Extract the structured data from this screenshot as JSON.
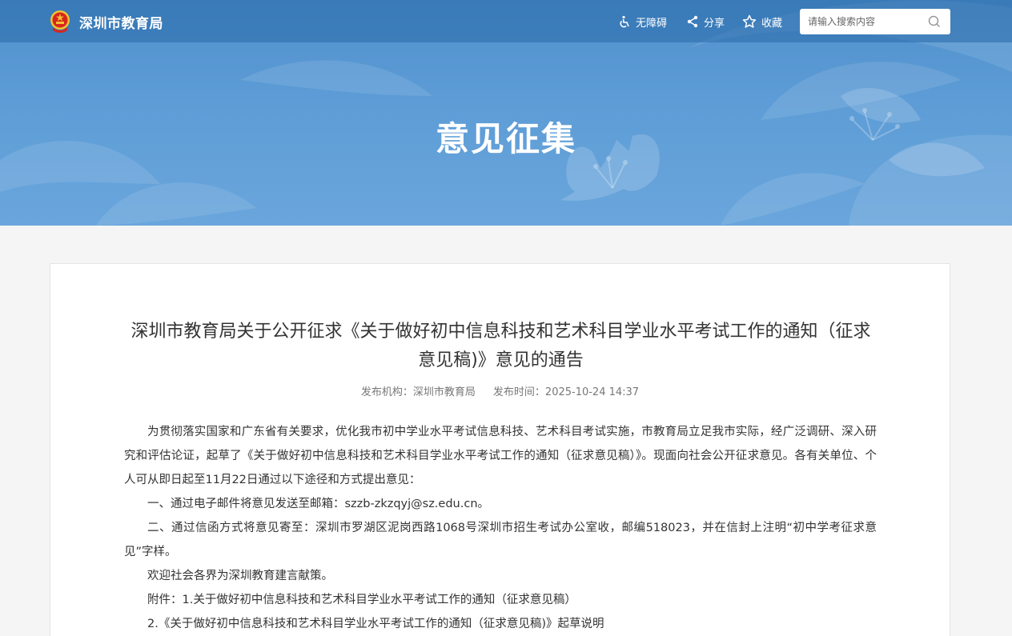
{
  "header": {
    "site_name": "深圳市教育局",
    "tools": {
      "accessibility": "无障碍",
      "share": "分享",
      "favorite": "收藏"
    },
    "search": {
      "placeholder": "请输入搜索内容",
      "value": ""
    }
  },
  "banner": {
    "title": "意见征集"
  },
  "article": {
    "title": "深圳市教育局关于公开征求《关于做好初中信息科技和艺术科目学业水平考试工作的通知（征求意见稿)》意见的通告",
    "publisher": "发布机构：深圳市教育局",
    "publish_time": "发布时间：2025-10-24 14:37",
    "paragraphs": [
      "为贯彻落实国家和广东省有关要求，优化我市初中学业水平考试信息科技、艺术科目考试实施，市教育局立足我市实际，经广泛调研、深入研究和评估论证，起草了《关于做好初中信息科技和艺术科目学业水平考试工作的通知（征求意见稿）》。现面向社会公开征求意见。各有关单位、个人可从即日起至11月22日通过以下途径和方式提出意见：",
      "一、通过电子邮件将意见发送至邮箱：szzb-zkzqyj@sz.edu.cn。",
      "二、通过信函方式将意见寄至：深圳市罗湖区泥岗西路1068号深圳市招生考试办公室收，邮编518023，并在信封上注明“初中学考征求意见”字样。",
      "欢迎社会各界为深圳教育建言献策。",
      "附件：1.关于做好初中信息科技和艺术科目学业水平考试工作的通知（征求意见稿）",
      "2.《关于做好初中信息科技和艺术科目学业水平考试工作的通知（征求意见稿)》起草说明"
    ]
  },
  "colors": {
    "banner_top": "#4f8fcb",
    "banner_bottom": "#6aa6dc",
    "emblem_red": "#d7261d",
    "emblem_gold": "#f2c230"
  }
}
